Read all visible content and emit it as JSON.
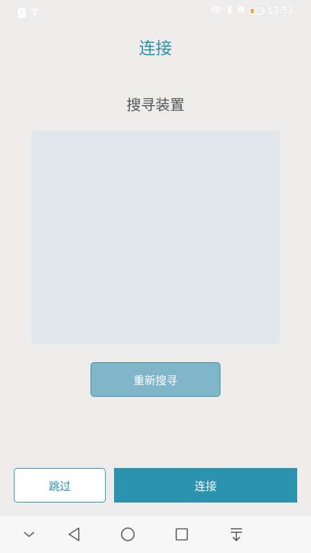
{
  "status_bar": {
    "time": "13:53",
    "battery_level": "11",
    "icons": [
      "sim-alert-icon",
      "wifi-icon",
      "eye-icon",
      "bluetooth-icon",
      "mute-icon",
      "battery-icon"
    ]
  },
  "header": {
    "title": "连接"
  },
  "search": {
    "title": "搜寻装置",
    "device_list": [],
    "rescan_label": "重新搜寻"
  },
  "footer": {
    "skip_label": "跳过",
    "connect_label": "连接"
  },
  "nav_bar": {
    "icons": [
      "chevron-down-icon",
      "back-triangle-icon",
      "home-circle-icon",
      "recents-square-icon",
      "notification-pull-icon"
    ]
  },
  "colors": {
    "accent": "#2c93ae",
    "rescan_fill": "#7fb6c8",
    "panel": "#e1e8eb",
    "background": "#edeceb"
  }
}
